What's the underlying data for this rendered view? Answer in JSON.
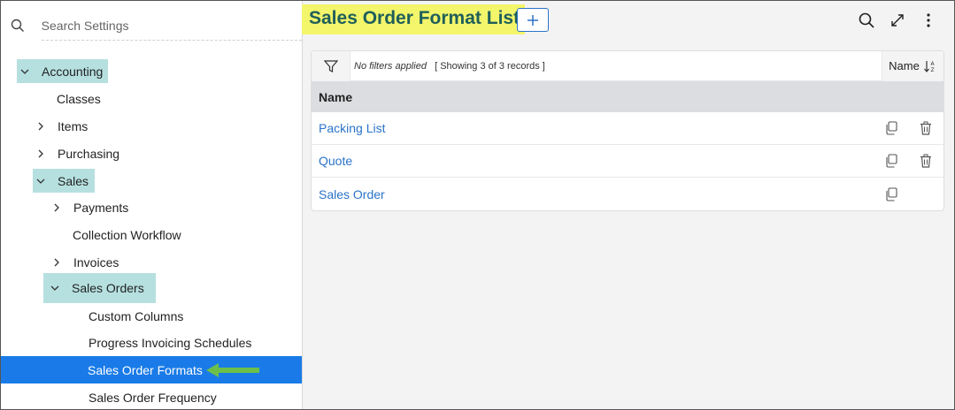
{
  "search": {
    "placeholder": "Search Settings"
  },
  "sidebar": {
    "accounting": "Accounting",
    "classes": "Classes",
    "items": "Items",
    "purchasing": "Purchasing",
    "sales": "Sales",
    "payments": "Payments",
    "collection_workflow": "Collection Workflow",
    "invoices": "Invoices",
    "sales_orders": "Sales Orders",
    "custom_columns": "Custom Columns",
    "progress_invoicing": "Progress Invoicing Schedules",
    "sales_order_formats": "Sales Order Formats",
    "sales_order_frequency": "Sales Order Frequency"
  },
  "header": {
    "title": "Sales Order Format List"
  },
  "filter": {
    "no_filters": "No filters applied",
    "showing": "[ Showing 3 of 3 records ]",
    "sort_label": "Name"
  },
  "table": {
    "column": "Name",
    "rows": [
      "Packing List",
      "Quote",
      "Sales Order"
    ]
  },
  "colors": {
    "highlight": "#b6e0e0",
    "selected": "#1a7be8",
    "title_highlight": "#f3f56a",
    "link": "#2b73c9",
    "arrow": "#6cc04a"
  }
}
